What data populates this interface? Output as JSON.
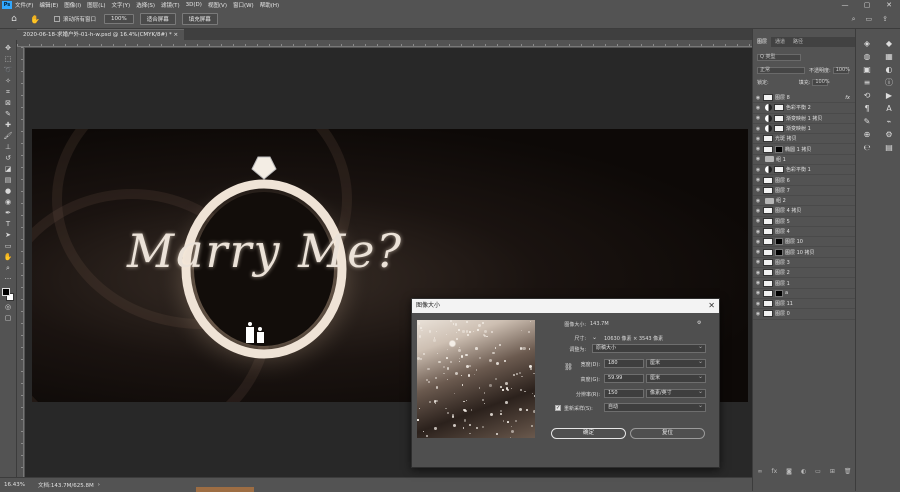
{
  "app": {
    "logo": "Ps",
    "menu": [
      "文件(F)",
      "编辑(E)",
      "图像(I)",
      "图层(L)",
      "文字(Y)",
      "选择(S)",
      "滤镜(T)",
      "3D(D)",
      "视图(V)",
      "窗口(W)",
      "帮助(H)"
    ],
    "window_controls": [
      "—",
      "▢",
      "✕"
    ]
  },
  "options_bar": {
    "scroll_all_label": "滚动所有窗口",
    "zoom_value": "100%",
    "fit_screen": "适合屏幕",
    "fill_screen": "填充屏幕"
  },
  "document": {
    "tab_title": "2020-06-18-求婚户外-01-h-w.psd @ 16.4%(CMYK/8#) *",
    "art_text": "Marry Me?"
  },
  "status_bar": {
    "zoom": "16.43%",
    "doc_info": "文档:143.7M/625.8M",
    "progress": 0.08
  },
  "panels": {
    "tabs": [
      "图层",
      "通道",
      "路径"
    ],
    "filter_kind": "Q 类型",
    "blend_mode": "正常",
    "opacity_label": "不透明度:",
    "opacity": "100%",
    "lock_label": "锁定:",
    "fill_label": "填充:",
    "fill": "100%",
    "layers": [
      {
        "name": "图层 8",
        "kind": "image",
        "fx": "fx"
      },
      {
        "name": "色彩平衡 2",
        "kind": "adjust"
      },
      {
        "name": "渐变映射 1 拷贝",
        "kind": "adjust"
      },
      {
        "name": "渐变映射 1",
        "kind": "adjust"
      },
      {
        "name": "光斑 拷贝",
        "kind": "image"
      },
      {
        "name": "椭圆 1 拷贝",
        "kind": "image"
      },
      {
        "name": "组 1",
        "kind": "group"
      },
      {
        "name": "色彩平衡 1",
        "kind": "adjust"
      },
      {
        "name": "图层 6",
        "kind": "image"
      },
      {
        "name": "图层 7",
        "kind": "image"
      },
      {
        "name": "组 2",
        "kind": "group"
      },
      {
        "name": "图层 4 拷贝",
        "kind": "image"
      },
      {
        "name": "图层 5",
        "kind": "image"
      },
      {
        "name": "图层 4",
        "kind": "image"
      },
      {
        "name": "图层 10",
        "kind": "image"
      },
      {
        "name": "图层 10 拷贝",
        "kind": "image"
      },
      {
        "name": "图层 3",
        "kind": "image"
      },
      {
        "name": "图层 2",
        "kind": "image"
      },
      {
        "name": "图层 1",
        "kind": "image"
      },
      {
        "name": "a",
        "kind": "image"
      },
      {
        "name": "图层 11",
        "kind": "image"
      },
      {
        "name": "图层 0",
        "kind": "image"
      }
    ]
  },
  "dialog": {
    "title": "图像大小",
    "image_size_label": "图像大小:",
    "image_size_value": "143.7M",
    "dimensions_label": "尺寸:",
    "dimensions_value": "10630 像素 × 3543 像素",
    "fit_to_label": "调整为:",
    "fit_to_value": "原稿大小",
    "width_label": "宽度(D):",
    "width_value": "180",
    "width_unit": "厘米",
    "height_label": "高度(G):",
    "height_value": "59.99",
    "height_unit": "厘米",
    "resolution_label": "分辨率(R):",
    "resolution_value": "150",
    "resolution_unit": "像素/英寸",
    "resample_label": "重新采样(S):",
    "resample_value": "自动",
    "ok": "确定",
    "reset": "复位"
  }
}
